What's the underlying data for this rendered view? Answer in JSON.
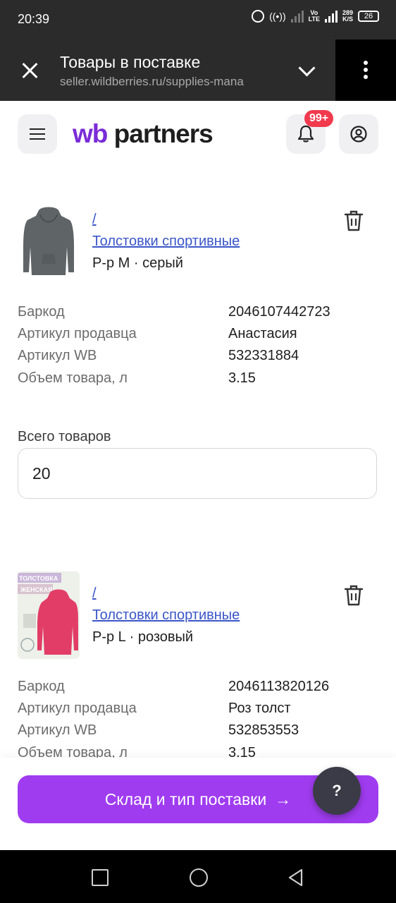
{
  "status_bar": {
    "time": "20:39",
    "net_speed": "289\nK/S",
    "battery": "26",
    "volte": "Vo\nLTE",
    "net_type": "4G"
  },
  "browser": {
    "title": "Товары в поставке",
    "url": "seller.wildberries.ru/supplies-mana"
  },
  "app_header": {
    "logo_wb": "wb",
    "logo_partners": "partners",
    "notification_badge": "99+"
  },
  "products": [
    {
      "slash": "/",
      "category": "Толстовки спортивные",
      "variant": "Р-р M · серый",
      "specs": [
        {
          "label": "Баркод",
          "value": "2046107442723"
        },
        {
          "label": "Артикул продавца",
          "value": "Анастасия"
        },
        {
          "label": "Артикул WB",
          "value": "532331884"
        },
        {
          "label": "Объем товара, л",
          "value": "3.15"
        }
      ],
      "qty_label": "Всего товаров",
      "qty_value": "20"
    },
    {
      "slash": "/",
      "category": "Толстовки спортивные",
      "variant": "Р-р L · розовый",
      "thumb_text_1": "ТОЛСТОВКА",
      "thumb_text_2": "ЖЕНСКАЯ",
      "specs": [
        {
          "label": "Баркод",
          "value": "2046113820126"
        },
        {
          "label": "Артикул продавца",
          "value": "Роз толст"
        },
        {
          "label": "Артикул WB",
          "value": "532853553"
        },
        {
          "label": "Объем товара, л",
          "value": "3.15"
        }
      ]
    }
  ],
  "cta": {
    "label": "Склад и тип поставки",
    "arrow": "→"
  },
  "help": {
    "label": "?"
  },
  "colors": {
    "accent": "#a03cf0",
    "link": "#3a55c8",
    "badge": "#f13a4d",
    "logo": "#7a2bd8"
  }
}
